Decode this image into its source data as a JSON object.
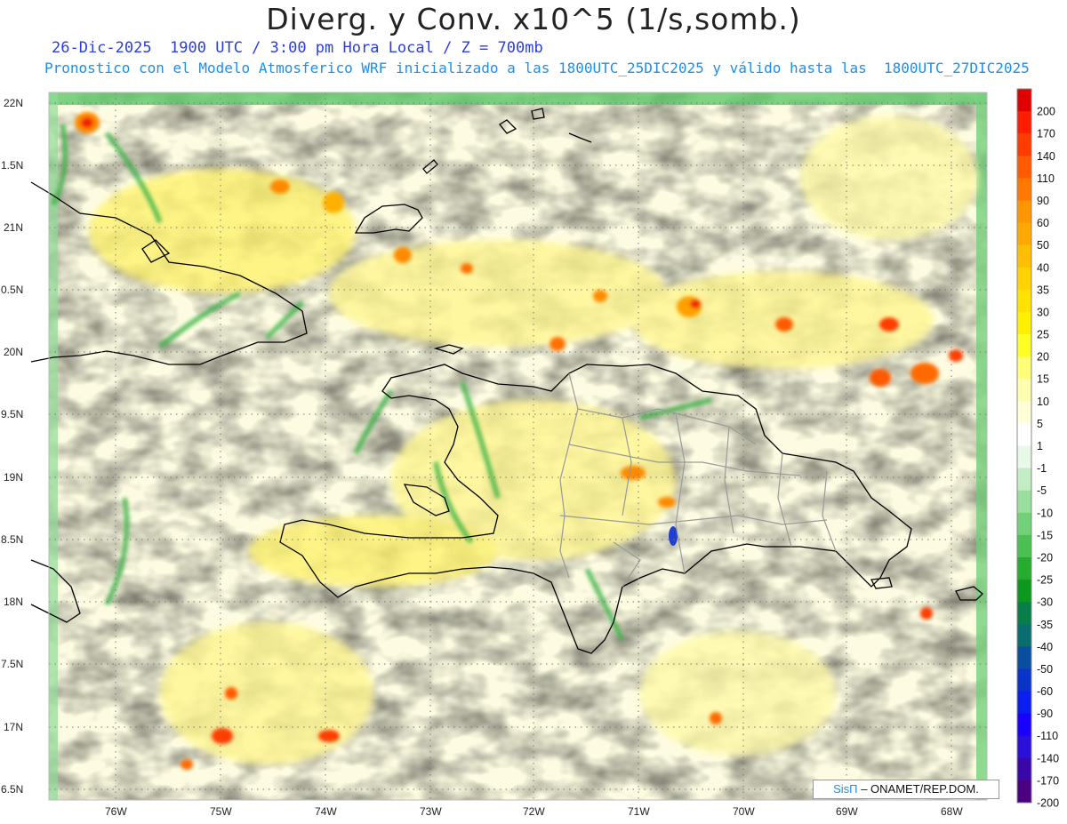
{
  "title": "Diverg. y Conv. x10^5 (1/s,somb.)",
  "subtitle_1": "26-Dic-2025  1900 UTC / 3:00 pm Hora Local / Z = 700mb",
  "subtitle_2": "Pronostico con el Modelo Atmosferico WRF inicializado a las 1800UTC_25DIC2025 y válido hasta las  1800UTC_27DIC2025",
  "credit": {
    "brand": "SisΠ",
    "text": "– ONAMET/REP.DOM."
  },
  "map": {
    "lon_labels": [
      "76W",
      "75W",
      "74W",
      "73W",
      "72W",
      "71W",
      "70W",
      "69W",
      "68W"
    ],
    "lat_labels": [
      "22N",
      "1.5N",
      "21N",
      "0.5N",
      "20N",
      "9.5N",
      "19N",
      "8.5N",
      "18N",
      "7.5N",
      "17N",
      "6.5N"
    ]
  },
  "colorbar": {
    "labels": [
      "200",
      "170",
      "140",
      "110",
      "90",
      "60",
      "50",
      "40",
      "35",
      "30",
      "25",
      "20",
      "15",
      "10",
      "5",
      "1",
      "-1",
      "-5",
      "-10",
      "-15",
      "-20",
      "-25",
      "-30",
      "-35",
      "-40",
      "-50",
      "-60",
      "-90",
      "-110",
      "-140",
      "-170",
      "-200"
    ],
    "colors": [
      "#e00000",
      "#ff1c00",
      "#ff3c00",
      "#ff5a00",
      "#ff7800",
      "#ff9600",
      "#ffa800",
      "#ffbe00",
      "#ffd200",
      "#ffe200",
      "#fff000",
      "#ffff28",
      "#ffff78",
      "#ffffb0",
      "#ffffd8",
      "#ffffff",
      "#eaf8ea",
      "#c2ecc4",
      "#9adf9e",
      "#72d078",
      "#4cc052",
      "#28ac30",
      "#0f9820",
      "#0a7e48",
      "#0a6e6e",
      "#0a4ea0",
      "#0a34c8",
      "#0a1ef0",
      "#1a00ff",
      "#2a10d8",
      "#3a08a8",
      "#4a0080"
    ]
  }
}
